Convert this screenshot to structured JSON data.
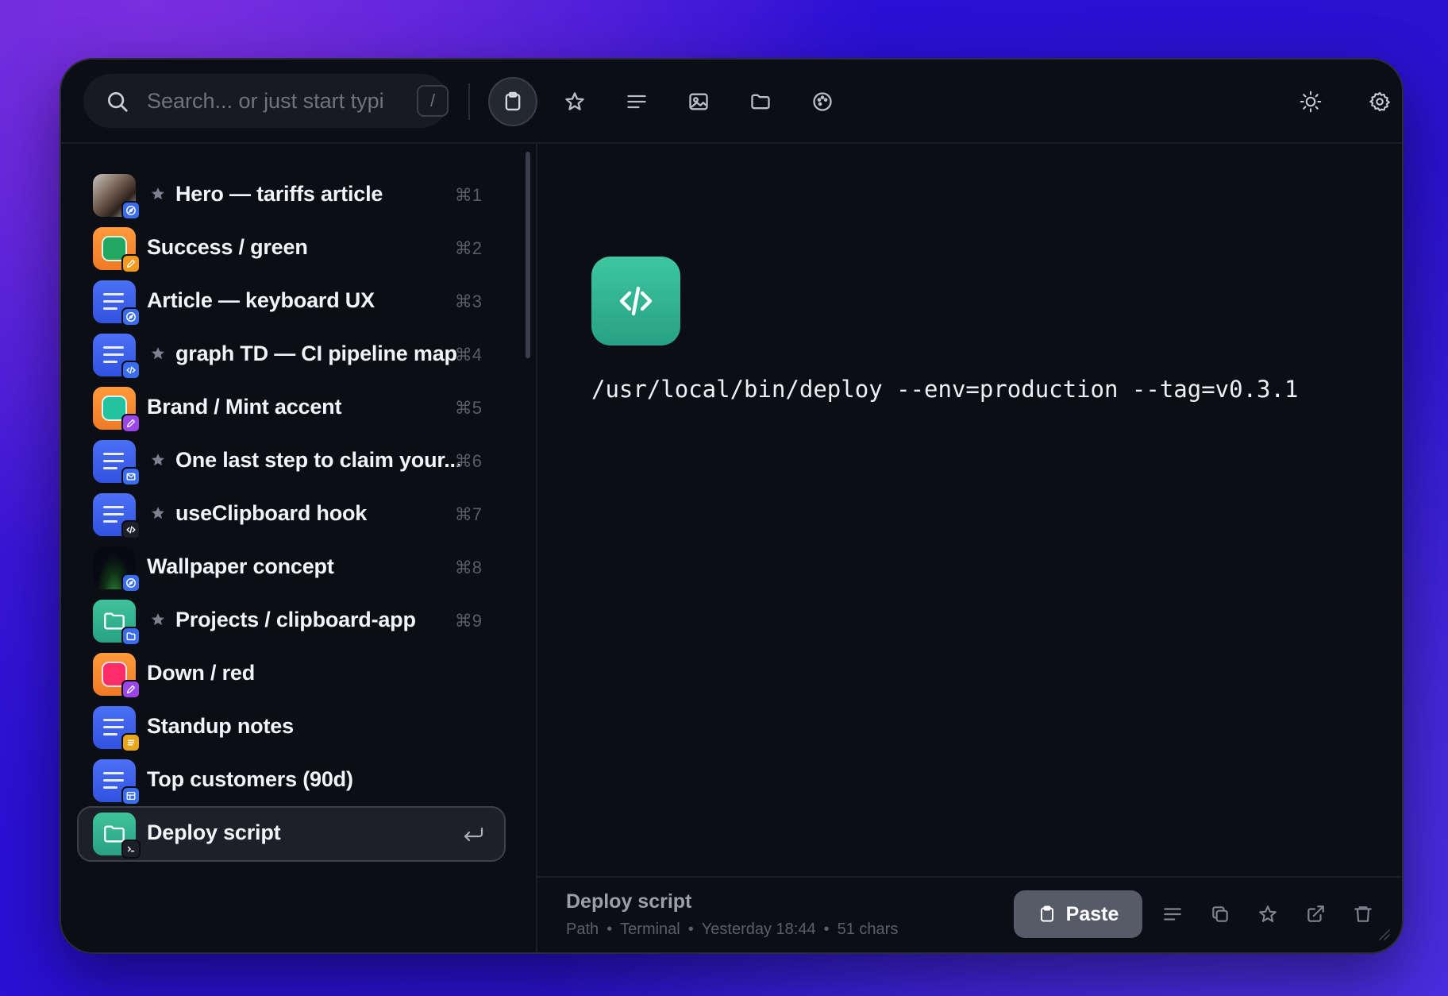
{
  "search": {
    "placeholder": "Search... or just start typi",
    "shortcut": "/"
  },
  "toolbar": {
    "filters": [
      {
        "icon": "clipboard-icon",
        "active": true
      },
      {
        "icon": "star-icon",
        "active": false
      },
      {
        "icon": "text-lines-icon",
        "active": false
      },
      {
        "icon": "image-icon",
        "active": false
      },
      {
        "icon": "folder-icon",
        "active": false
      },
      {
        "icon": "palette-icon",
        "active": false
      }
    ],
    "right": [
      {
        "icon": "sun-icon"
      },
      {
        "icon": "gear-icon"
      }
    ]
  },
  "items": [
    {
      "label": "Hero — tariffs article",
      "shortcut": "⌘1",
      "starred": true,
      "thumb": "photo",
      "badge": "safari-icon",
      "badge_color": "#3a6cf0"
    },
    {
      "label": "Success / green",
      "shortcut": "⌘2",
      "starred": false,
      "thumb": "color",
      "swatch": "#22a860",
      "badge": "pencil-icon",
      "badge_color": "#f59a1f"
    },
    {
      "label": "Article — keyboard UX",
      "shortcut": "⌘3",
      "starred": false,
      "thumb": "text",
      "badge": "safari-icon",
      "badge_color": "#3a6cf0"
    },
    {
      "label": "graph TD — CI pipeline map",
      "shortcut": "⌘4",
      "starred": true,
      "thumb": "text",
      "badge": "code-icon",
      "badge_color": "#3a6cf0"
    },
    {
      "label": "Brand / Mint accent",
      "shortcut": "⌘5",
      "starred": false,
      "thumb": "color",
      "swatch": "#24c3a0",
      "badge": "pencil-icon",
      "badge_color": "#9b46e8"
    },
    {
      "label": "One last step to claim your...",
      "shortcut": "⌘6",
      "starred": true,
      "thumb": "text",
      "badge": "mail-icon",
      "badge_color": "#3a6cf0"
    },
    {
      "label": "useClipboard hook",
      "shortcut": "⌘7",
      "starred": true,
      "thumb": "text",
      "badge": "code-icon",
      "badge_color": "#1c1f27"
    },
    {
      "label": "Wallpaper concept",
      "shortcut": "⌘8",
      "starred": false,
      "thumb": "wallpaper",
      "badge": "safari-icon",
      "badge_color": "#3a6cf0"
    },
    {
      "label": "Projects / clipboard-app",
      "shortcut": "⌘9",
      "starred": true,
      "thumb": "folder",
      "badge": "finder-icon",
      "badge_color": "#3a6cf0"
    },
    {
      "label": "Down / red",
      "shortcut": "",
      "starred": false,
      "thumb": "color",
      "swatch": "#ff2d6a",
      "badge": "pencil-icon",
      "badge_color": "#9b46e8"
    },
    {
      "label": "Standup notes",
      "shortcut": "",
      "starred": false,
      "thumb": "text",
      "badge": "notes-icon",
      "badge_color": "#e9a61d"
    },
    {
      "label": "Top customers (90d)",
      "shortcut": "",
      "starred": false,
      "thumb": "text",
      "badge": "table-icon",
      "badge_color": "#3a6cf0"
    },
    {
      "label": "Deploy script",
      "shortcut": "",
      "starred": false,
      "thumb": "folder",
      "badge": "terminal-icon",
      "badge_color": "#1c1f27",
      "selected": true
    }
  ],
  "detail": {
    "type_icon": "code-icon",
    "content": "/usr/local/bin/deploy --env=production --tag=v0.3.1",
    "title": "Deploy script",
    "meta": {
      "kind": "Path",
      "app": "Terminal",
      "time": "Yesterday 18:44",
      "chars": "51 chars"
    },
    "paste_label": "Paste",
    "actions": [
      "text-lines-icon",
      "copy-icon",
      "star-icon",
      "open-external-icon",
      "trash-icon"
    ]
  },
  "colors": {
    "accent_teal": "#2fb48f",
    "window_bg": "#0b0e14",
    "selected_bg": "#1d2029"
  }
}
